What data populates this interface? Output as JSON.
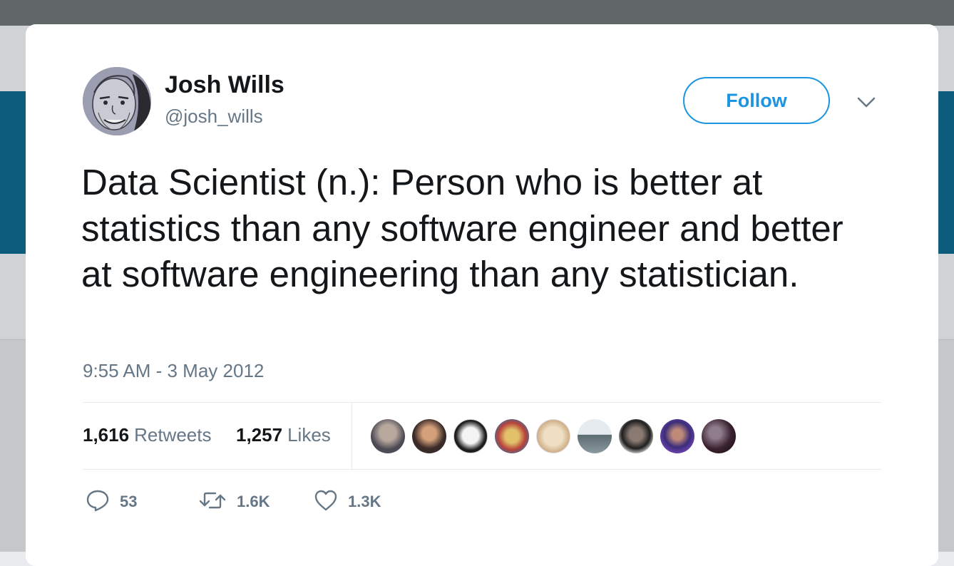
{
  "author": {
    "name": "Josh Wills",
    "handle": "@josh_wills"
  },
  "follow_label": "Follow",
  "tweet": {
    "text": "Data Scientist (n.): Person who is better at statistics than any software engineer and better at software engineering than any statistician.",
    "timestamp": "9:55 AM - 3 May 2012"
  },
  "stats": {
    "retweets_count": "1,616",
    "retweets_label": "Retweets",
    "likes_count": "1,257",
    "likes_label": "Likes"
  },
  "actions": {
    "reply_count": "53",
    "retweet_count": "1.6K",
    "like_count": "1.3K"
  },
  "colors": {
    "accent": "#1b95e0",
    "secondary_text": "#657786",
    "primary_text": "#14171a",
    "banner": "#0d5c7d"
  },
  "icons": {
    "caret": "chevron-down-icon",
    "reply": "speech-bubble-icon",
    "retweet": "retweet-arrows-icon",
    "like": "heart-outline-icon"
  }
}
